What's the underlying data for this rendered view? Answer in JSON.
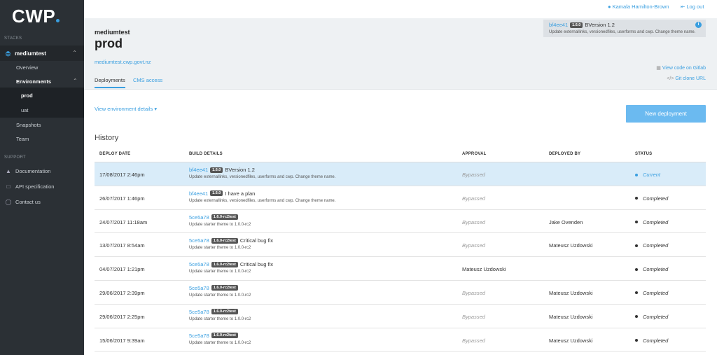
{
  "sidebar": {
    "logo": "CWP",
    "stacks_heading": "STACKS",
    "stack_name": "mediumtest",
    "overview": "Overview",
    "environments": "Environments",
    "env_prod": "prod",
    "env_uat": "uat",
    "snapshots": "Snapshots",
    "team": "Team",
    "support_heading": "SUPPORT",
    "documentation": "Documentation",
    "api_spec": "API specification",
    "contact": "Contact us"
  },
  "topbar": {
    "user": "Kamala Hamilton-Brown",
    "logout": "Log out"
  },
  "header": {
    "stack_name": "mediumtest",
    "env_name": "prod",
    "url": "mediumtest.cwp.govt.nz",
    "tab_deployments": "Deployments",
    "tab_cms": "CMS access",
    "commit": {
      "hash": "bf4ee41",
      "badge": "1.6.0",
      "title": "BVersion 1.2",
      "message": "Update externallinks, versionedfiles, userforms and cwp. Change theme name."
    },
    "view_gitlab": "View code on Gitlab",
    "git_clone": "Git clone URL"
  },
  "main": {
    "view_details": "View environment details",
    "new_deployment": "New deployment",
    "history_title": "History"
  },
  "table": {
    "headers": [
      "DEPLOY DATE",
      "BUILD DETAILS",
      "APPROVAL",
      "DEPLOYED BY",
      "STATUS"
    ],
    "rows": [
      {
        "date": "17/08/2017 2:46pm",
        "hash": "bf4ee41",
        "badge": "1.6.0",
        "title": "BVersion 1.2",
        "message": "Update externallinks, versionedfiles, userforms and cwp. Change theme name.",
        "approval": "Bypassed",
        "deployer": "",
        "status": "Current"
      },
      {
        "date": "26/07/2017 1:46pm",
        "hash": "bf4ee41",
        "badge": "1.6.0",
        "title": "I have a plan",
        "message": "Update externallinks, versionedfiles, userforms and cwp. Change theme name.",
        "approval": "Bypassed",
        "deployer": "",
        "status": "Completed"
      },
      {
        "date": "24/07/2017 11:18am",
        "hash": "5ce5a78",
        "badge": "1.6.0-rc2test",
        "title": "",
        "message": "Update starter theme to 1.0.0-rc2",
        "approval": "Bypassed",
        "deployer": "Jake Ovenden",
        "status": "Completed"
      },
      {
        "date": "13/07/2017 8:54am",
        "hash": "5ce5a78",
        "badge": "1.6.0-rc2test",
        "title": "Critical bug fix",
        "message": "Update starter theme to 1.0.0-rc2",
        "approval": "Bypassed",
        "deployer": "Mateusz Uzdowski",
        "status": "Completed"
      },
      {
        "date": "04/07/2017 1:21pm",
        "hash": "5ce5a78",
        "badge": "1.6.0-rc2test",
        "title": "Critical bug fix",
        "message": "Update starter theme to 1.0.0-rc2",
        "approval": "Mateusz Uzdowski",
        "deployer": "",
        "status": "Completed"
      },
      {
        "date": "29/06/2017 2:39pm",
        "hash": "5ce5a78",
        "badge": "1.6.0-rc2test",
        "title": "",
        "message": "Update starter theme to 1.0.0-rc2",
        "approval": "Bypassed",
        "deployer": "Mateusz Uzdowski",
        "status": "Completed"
      },
      {
        "date": "29/06/2017 2:25pm",
        "hash": "5ce5a78",
        "badge": "1.6.0-rc2test",
        "title": "",
        "message": "Update starter theme to 1.0.0-rc2",
        "approval": "Bypassed",
        "deployer": "Mateusz Uzdowski",
        "status": "Completed"
      },
      {
        "date": "15/06/2017 9:39am",
        "hash": "5ce5a78",
        "badge": "1.6.0-rc2test",
        "title": "",
        "message": "Update starter theme to 1.0.0-rc2",
        "approval": "Bypassed",
        "deployer": "Mateusz Uzdowski",
        "status": "Completed"
      }
    ]
  },
  "colors": {
    "accent": "#3a9fe0",
    "sidebar_bg": "#2b3035",
    "current_row_bg": "#d9ecf9"
  }
}
